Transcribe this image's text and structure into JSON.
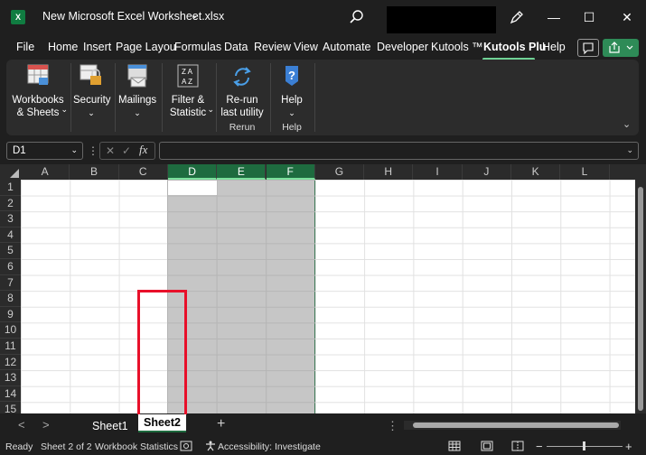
{
  "titlebar": {
    "app_icon": "excel-icon",
    "app_icon_text": "X",
    "document_title": "New Microsoft Excel Worksheet.xlsx",
    "title_chevron": "⌄",
    "minimize": "—",
    "maximize": "☐",
    "close": "✕"
  },
  "menu": {
    "tabs": [
      "File",
      "Home",
      "Insert",
      "Page Layou",
      "Formulas",
      "Data",
      "Review",
      "View",
      "Automate",
      "Developer",
      "Kutools ™",
      "Kutools Plu",
      "Help"
    ],
    "active_tab": "Kutools Plu"
  },
  "ribbon": {
    "workbooks_sheets": "Workbooks & Sheets",
    "security": "Security",
    "mailings": "Mailings",
    "filter_statistic": "Filter & Statistic",
    "rerun": "Re-run last utility",
    "help": "Help",
    "group_rerun": "Rerun",
    "group_help": "Help",
    "dropdown_chevron": "⌄",
    "collapse": "⌄"
  },
  "formula_bar": {
    "name_box": "D1",
    "dots": "⋮",
    "cancel": "✕",
    "enter": "✓",
    "fx": "fx",
    "value": ""
  },
  "grid": {
    "columns": [
      "A",
      "B",
      "C",
      "D",
      "E",
      "F",
      "G",
      "H",
      "I",
      "J",
      "K",
      "L"
    ],
    "selected_columns": [
      "D",
      "E",
      "F"
    ],
    "rows": [
      "1",
      "2",
      "3",
      "4",
      "5",
      "6",
      "7",
      "8",
      "9",
      "10",
      "11",
      "12",
      "13",
      "14",
      "15"
    ],
    "active_cell": "D1"
  },
  "sheets": {
    "prev": "<",
    "next": ">",
    "tabs": [
      "Sheet1",
      "Sheet2"
    ],
    "active": "Sheet2",
    "add": "+",
    "more": "⋮"
  },
  "status": {
    "ready": "Ready",
    "sheet_pos": "Sheet 2 of 2",
    "workbook_statistics": "Workbook Statistics",
    "accessibility": "Accessibility: Investigate",
    "zoom_minus": "−",
    "zoom_plus": "+"
  },
  "colors": {
    "selection_green": "#1e6b3f",
    "annotation_red": "#e8102a",
    "active_tab_underline": "#6fd295"
  }
}
